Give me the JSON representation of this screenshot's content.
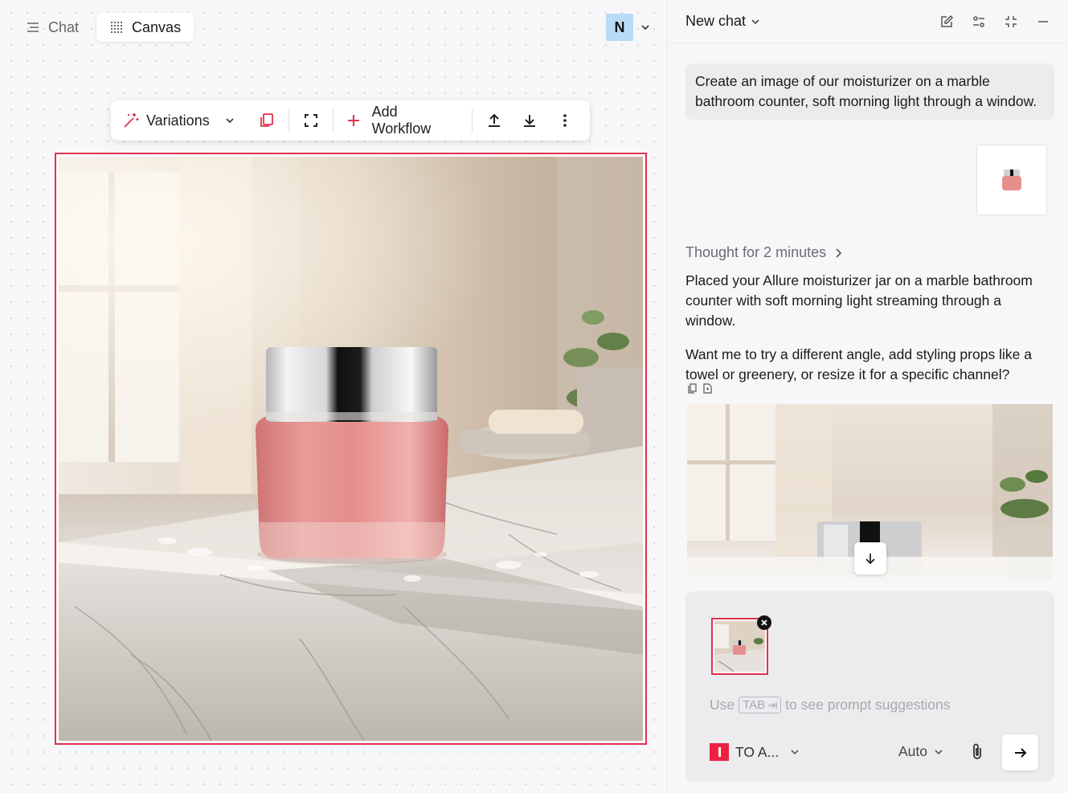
{
  "tabs": [
    {
      "label": "Chat",
      "active": false,
      "icon": "menu-lines-icon"
    },
    {
      "label": "Canvas",
      "active": true,
      "icon": "dot-grid-icon"
    }
  ],
  "user": {
    "initial": "N"
  },
  "toolbar": {
    "variations_label": "Variations",
    "add_workflow_label": "Add Workflow",
    "accent": "#e0314b"
  },
  "chat": {
    "title": "New chat",
    "user_message": "Create an image of our moisturizer on a marble bathroom counter, soft morning light through a window.",
    "thought_label": "Thought for 2 minutes",
    "reply_1": "Placed your Allure moisturizer jar on a marble bathroom counter with soft morning light streaming through a window.",
    "reply_2": "Want me to try a different angle, add styling props like a towel or greenery, or resize it for a specific channel?"
  },
  "composer": {
    "hint_prefix": "Use",
    "hint_key": "TAB",
    "hint_suffix": "to see prompt suggestions",
    "model_label": "TO A...",
    "mode_label": "Auto"
  }
}
